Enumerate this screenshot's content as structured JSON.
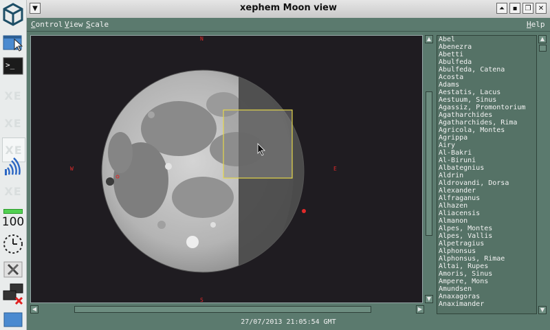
{
  "window": {
    "title": "xephem Moon view"
  },
  "dock": {
    "items": [
      "cube-logo",
      "window-cursor",
      "terminal",
      "XE",
      "XE",
      "XE",
      "wifi",
      "XE",
      "battery",
      "clock",
      "tools",
      "network",
      "window"
    ],
    "xe_label": "XE",
    "battery_level": "100"
  },
  "menu": {
    "control": "Control",
    "view": "View",
    "scale": "Scale",
    "help": "Help"
  },
  "compass": {
    "n": "N",
    "s": "S",
    "e": "E",
    "w": "W"
  },
  "features": [
    "Abel",
    "Abenezra",
    "Abetti",
    "Abulfeda",
    "Abulfeda, Catena",
    "Acosta",
    "Adams",
    "Aestatis, Lacus",
    "Aestuum, Sinus",
    "Agassiz, Promontorium",
    "Agatharchides",
    "Agatharchides, Rima",
    "Agricola, Montes",
    "Agrippa",
    "Airy",
    "Al-Bakri",
    "Al-Biruni",
    "Albategnius",
    "Aldrin",
    "Aldrovandi, Dorsa",
    "Alexander",
    "Alfraganus",
    "Alhazen",
    "Aliacensis",
    "Almanon",
    "Alpes, Montes",
    "Alpes, Vallis",
    "Alpetragius",
    "Alphonsus",
    "Alphonsus, Rimae",
    "Altai, Rupes",
    "Amoris, Sinus",
    "Ampere, Mons",
    "Amundsen",
    "Anaxagoras",
    "Anaximander"
  ],
  "status": {
    "datetime": "27/07/2013 21:05:54 GMT"
  }
}
